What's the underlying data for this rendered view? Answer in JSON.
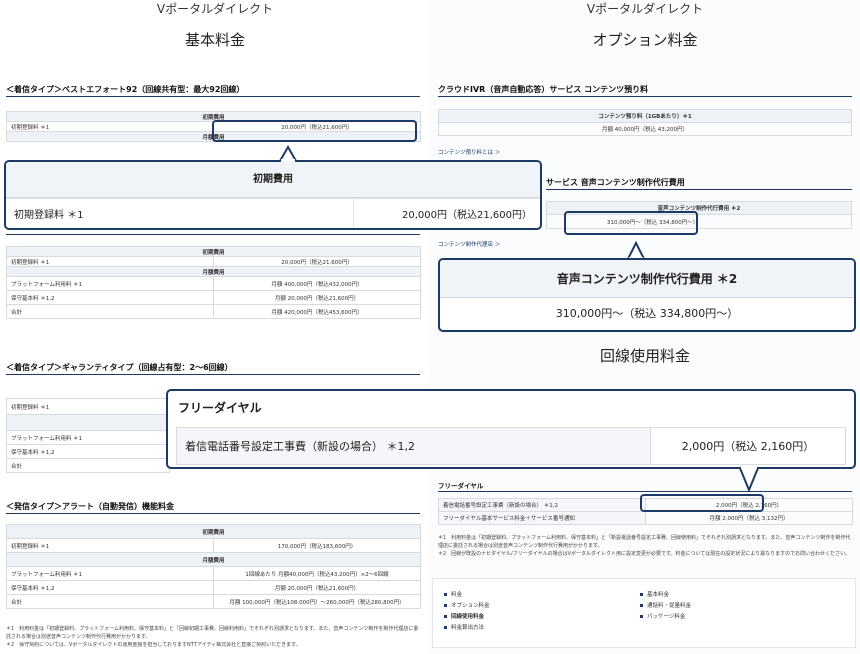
{
  "left": {
    "brand": "Vポータルダイレクト",
    "title": "基本料金",
    "sec1": {
      "heading": "＜着信タイプ＞ベストエフォート92（回線共有型：最大92回線）",
      "initial_header": "初期費用",
      "row1_label": "初期登録料 ＊1",
      "row1_value": "20,000円（税込21,600円）",
      "monthly_header": "月額費用"
    },
    "zoom": {
      "header": "初期費用",
      "label": "初期登録料 ＊1",
      "value": "20,000円（税込21,600円）"
    },
    "sec2": {
      "initial_header": "初期費用",
      "rows_initial": [
        [
          "初期登録料 ＊1",
          "20,000円（税込21,600円）"
        ]
      ],
      "monthly_header": "月額費用",
      "rows_monthly": [
        [
          "プラットフォーム利用料 ＊1",
          "月額 400,000円（税込432,000円）"
        ],
        [
          "保守基本料 ＊1,2",
          "月額 20,000円（税込21,600円）"
        ],
        [
          "合計",
          "月額 420,000円（税込453,600円）"
        ]
      ]
    },
    "sec3": {
      "heading": "＜着信タイプ＞ギャランティタイプ（回線占有型：2〜6回線）",
      "rows": [
        "初期登録料 ＊1",
        "プラットフォーム利用料 ＊1",
        "保守基本料 ＊1,2",
        "合計"
      ]
    },
    "sec4": {
      "heading": "＜発信タイプ＞アラート（自動発信）機能料金",
      "initial_header": "初期費用",
      "rows_initial": [
        [
          "初期登録料 ＊1",
          "170,000円（税込183,600円）"
        ]
      ],
      "monthly_header": "月額費用",
      "rows_monthly": [
        [
          "プラットフォーム利用料 ＊1",
          "1回線あたり 月額40,000円（税込43,200円）×2〜6回線"
        ],
        [
          "保守基本料 ＊1,2",
          "月額 20,000円（税込21,600円）"
        ],
        [
          "合計",
          "月額 100,000円（税込108,000円）〜260,000円（税込280,800円）"
        ]
      ]
    },
    "notes": [
      "＊1　利用料金は「初期登録料、プラットフォーム利用料、保守基本料」と「回線初期工事費、回線利用料」でそれぞれ別請求となります。また、音声コンテンツ制作を制作代理店に委託される場合は別途音声コンテンツ制作代行費用がかかります。",
      "＊2　保守契約については、Vポータルダイレクトの運用金額を担当しておりますNTTアイティ株式会社と直接ご契約いただきます。"
    ]
  },
  "right": {
    "brand": "Vポータルダイレクト",
    "title": "オプション料金",
    "sec1": {
      "heading": "クラウドIVR（音声自動応答）サービス コンテンツ預り料",
      "header": "コンテンツ預り料（1GBあたり）＊1",
      "value": "月額 40,000円（税込 43,200円）",
      "link": "コンテンツ預り料とは ＞"
    },
    "sec2": {
      "heading": "サービス 音声コンテンツ制作代行費用",
      "header": "音声コンテンツ制作代行費用 ＊2",
      "value": "310,000円〜（税込 334,800円〜）",
      "link": "コンテンツ制作代理店 ＞"
    },
    "zoom2": {
      "header": "音声コンテンツ制作代行費用 ＊2",
      "value": "310,000円〜（税込 334,800円〜）"
    },
    "title2": "回線使用料金",
    "zoom3": {
      "title": "フリーダイヤル",
      "label": "着信電話番号設定工事費（新設の場合） ＊1,2",
      "value": "2,000円（税込 2,160円）"
    },
    "sec3": {
      "heading": "フリーダイヤル",
      "rows": [
        [
          "着信電話番号設定工事費（新設の場合） ＊1,2",
          "2,000円（税込 2,160円）"
        ],
        [
          "フリーダイヤル基本サービス料金＋サービス番号通知",
          "月額 2,000円（税込 3,132円）"
        ]
      ]
    },
    "notes": [
      "＊1　利用料金は「初期登録料、プラットフォーム利用料、保守基本料」と「新設電話番号設定工事費、回線使用料」でそれぞれ別請求となります。また、音声コンテンツ制作を制作代理店に委託される場合は別途音声コンテンツ制作代行費用がかかります。",
      "＊2　回線が既設のナビダイヤル/フリーダイヤルの場合はVポータルダイレクト用に設定変更が必要です。料金については現在の設定状況により異なりますのでお問い合わせください。"
    ],
    "nav": [
      "料金",
      "オプション料金",
      "回線使用料金",
      "料金算出方法",
      "基本料金",
      "通話料・従量料金",
      "パッケージ料金"
    ]
  }
}
